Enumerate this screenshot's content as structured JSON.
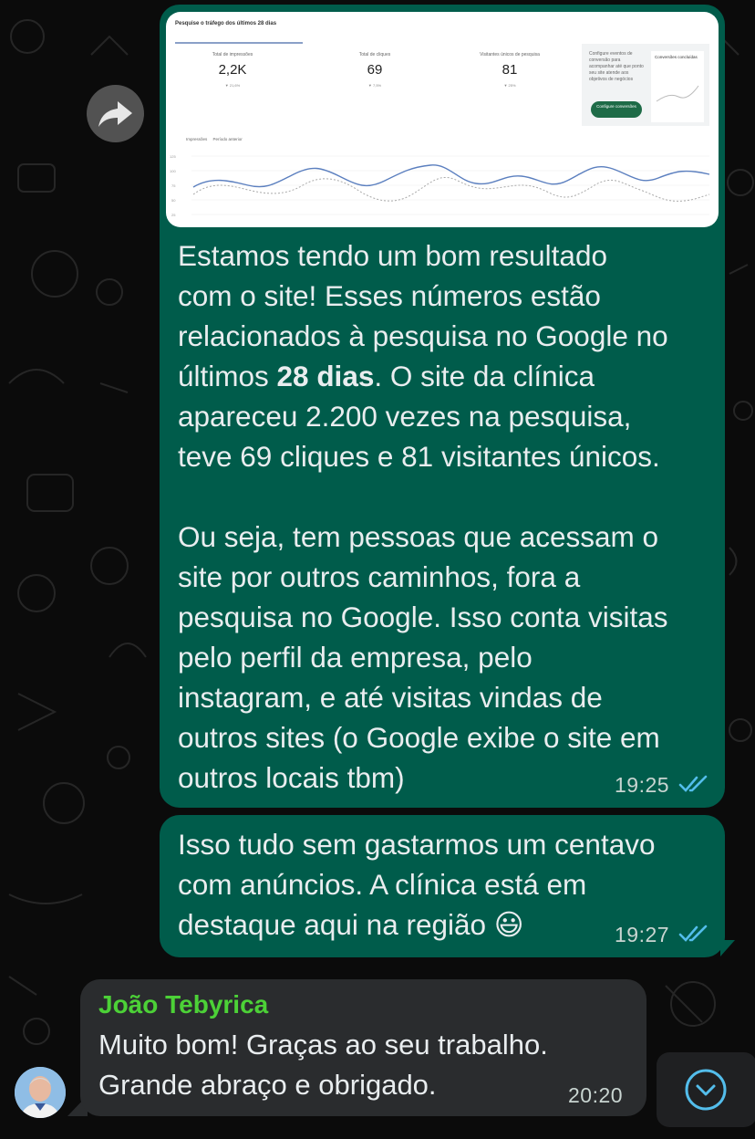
{
  "chat": {
    "messages": [
      {
        "id": "m1",
        "direction": "outgoing",
        "image": {
          "title": "Pesquise o tráfego dos últimos 28 dias",
          "kpis": [
            {
              "label": "Total de impressões",
              "value": "2,2K",
              "delta": "▼ 21,6%"
            },
            {
              "label": "Total de cliques",
              "value": "69",
              "delta": "▼ 7,5%"
            },
            {
              "label": "Visitantes únicos de pesquisa",
              "value": "81",
              "delta": "▼ 25%"
            }
          ],
          "conversions": {
            "text": "Configure eventos de conversão para acompanhar até que ponto seu site atende aos objetivos de negócios",
            "button": "Configure conversões",
            "card_title": "Conversões concluídas"
          },
          "legend": [
            "Impressões",
            "Período anterior"
          ]
        },
        "text_lines": [
          "Estamos tendo um bom resultado",
          "com o site! Esses números estão",
          "relacionados à pesquisa no Google no",
          "últimos ",
          "28 dias",
          ". O site da clínica",
          "apareceu 2.200 vezes na pesquisa,",
          "teve 69 cliques e 81 visitantes únicos.",
          "",
          "Ou seja, tem pessoas que acessam o",
          "site por outros caminhos, fora a",
          "pesquisa no Google. Isso conta visitas",
          "pelo perfil da empresa, pelo",
          "instagram, e até visitas vindas de",
          "outros sites (o Google exibe o site em",
          "outros locais tbm)"
        ],
        "time": "19:25",
        "status": "read"
      },
      {
        "id": "m2",
        "direction": "outgoing",
        "text_lines": [
          "Isso tudo sem gastarmos um centavo",
          "com anúncios. A clínica está em",
          "destaque aqui na região 😃"
        ],
        "time": "19:27",
        "status": "read"
      },
      {
        "id": "m3",
        "direction": "incoming",
        "sender": "João Tebyrica",
        "text_lines": [
          "Muito bom! Graças ao seu trabalho.",
          "Grande abraço e obrigado."
        ],
        "time": "20:20"
      }
    ]
  },
  "colors": {
    "outgoing_bubble": "#005c4b",
    "incoming_bubble": "#2a2c2e",
    "sender_name": "#4cd137",
    "read_ticks": "#53bdeb"
  },
  "icons": [
    "forward-icon",
    "double-check-icon",
    "scroll-down-icon",
    "avatar"
  ]
}
